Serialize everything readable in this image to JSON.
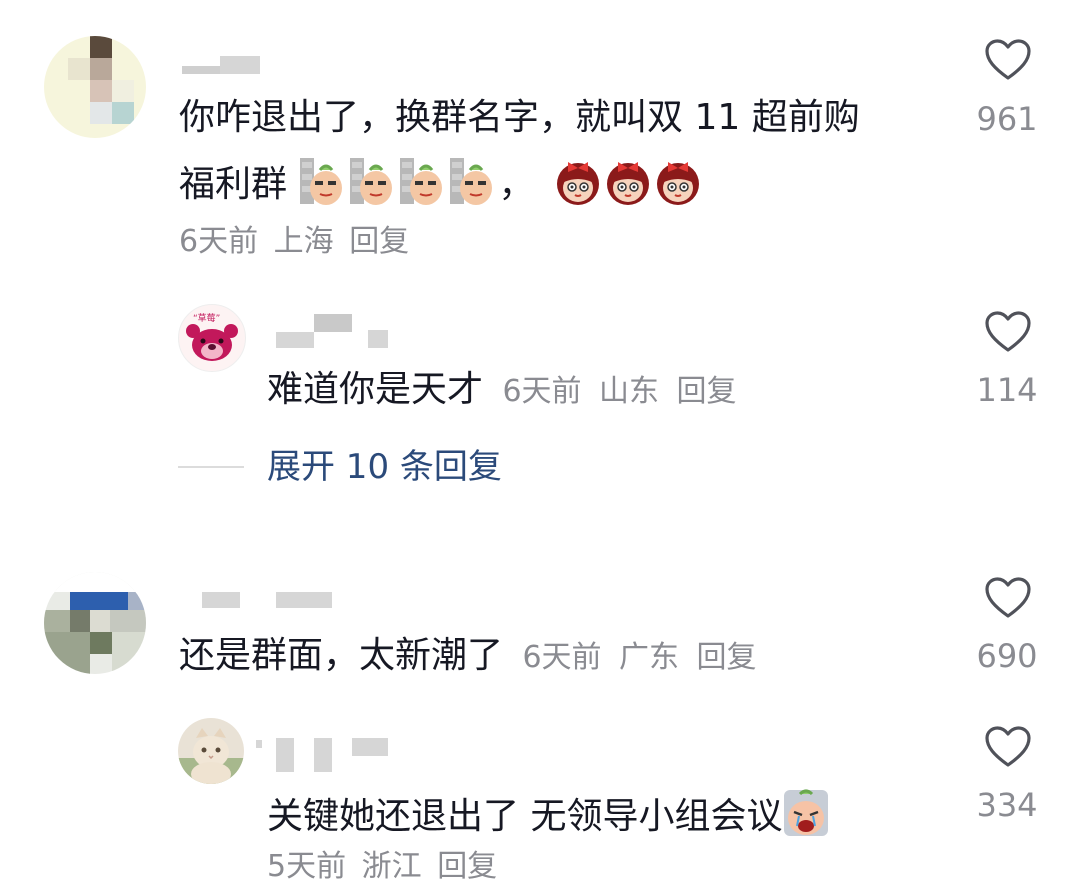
{
  "comments": [
    {
      "text": "你咋退出了，换群名字，就叫双 11 超前购",
      "text_line2": "福利群",
      "comma": "，",
      "time": "6天前",
      "location": "上海",
      "reply": "回复",
      "likes": "961",
      "replies": [
        {
          "text": "难道你是天才",
          "time": "6天前",
          "location": "山东",
          "reply": "回复",
          "likes": "114"
        }
      ],
      "expand_label": "展开 10 条回复"
    },
    {
      "text": "还是群面，太新潮了",
      "time": "6天前",
      "location": "广东",
      "reply": "回复",
      "likes": "690",
      "replies": [
        {
          "text": "关键她还退出了 无领导小组会议",
          "time": "5天前",
          "location": "浙江",
          "reply": "回复",
          "likes": "334"
        }
      ]
    }
  ],
  "colors": {
    "text": "#161823",
    "meta": "#8a8b91",
    "expand": "#2b4a7a",
    "background": "#ffffff"
  },
  "icons": {
    "like": "heart-outline-icon",
    "emoji_peach": "peach-smirk-emoji-icon",
    "emoji_girl": "girl-bow-emoji-icon",
    "emoji_cry": "crying-emoji-icon"
  }
}
